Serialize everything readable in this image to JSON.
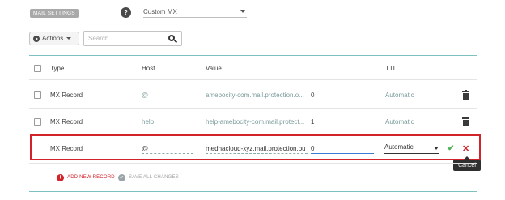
{
  "header": {
    "badge": "MAIL SETTINGS",
    "help_icon": "?",
    "mx_select_value": "Custom MX"
  },
  "toolbar": {
    "actions_label": "Actions",
    "search_placeholder": "Search"
  },
  "table": {
    "columns": [
      "Type",
      "Host",
      "Value",
      "TTL"
    ],
    "rows": [
      {
        "type": "MX Record",
        "host": "@",
        "value": "amebocity-com.mail.protection.o...",
        "priority": "0",
        "ttl": "Automatic"
      },
      {
        "type": "MX Record",
        "host": "help",
        "value": "help-amebocity-com.mail.protect...",
        "priority": "1",
        "ttl": "Automatic"
      }
    ],
    "edit_row": {
      "type": "MX Record",
      "host": "@",
      "value": "medhacloud-xyz.mail.protection.ou",
      "priority": "0",
      "ttl": "Automatic"
    }
  },
  "tooltip": "Cancel",
  "footer": {
    "add_label": "ADD NEW RECORD",
    "save_label": "SAVE ALL CHANGES"
  },
  "colors": {
    "accent_red": "#d2232a",
    "teal": "#7cc0c0"
  }
}
